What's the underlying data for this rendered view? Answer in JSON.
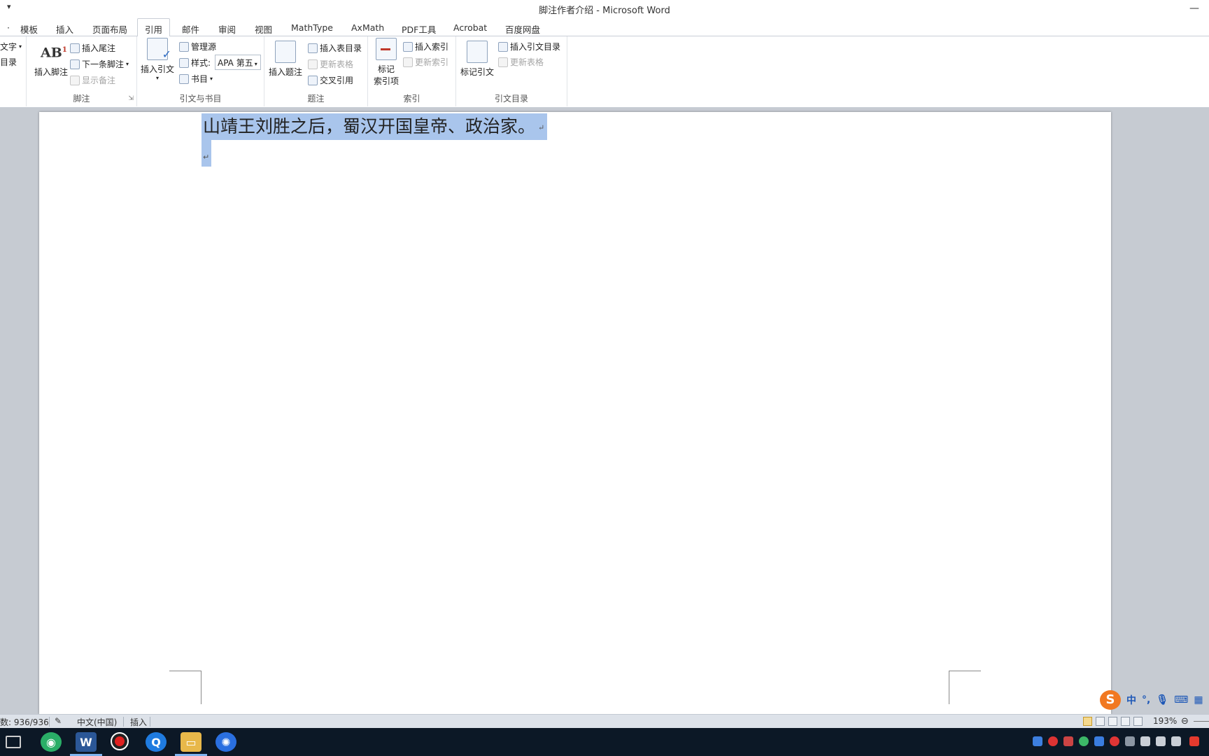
{
  "window": {
    "title": "脚注作者介绍 - Microsoft Word",
    "quick_access_arrow": "▾",
    "minimize_glyph": "—"
  },
  "tabs": [
    {
      "label": "模板"
    },
    {
      "label": "插入"
    },
    {
      "label": "页面布局"
    },
    {
      "label": "引用",
      "active": true
    },
    {
      "label": "邮件"
    },
    {
      "label": "审阅"
    },
    {
      "label": "视图"
    },
    {
      "label": "MathType"
    },
    {
      "label": "AxMath"
    },
    {
      "label": "PDF工具"
    },
    {
      "label": "Acrobat"
    },
    {
      "label": "百度网盘"
    }
  ],
  "ribbon": {
    "toc_group": {
      "add_text": "文字",
      "update_table": "目录"
    },
    "footnotes": {
      "label": "脚注",
      "insert_footnote": "插入脚注",
      "insert_endnote": "插入尾注",
      "next_footnote": "下一条脚注",
      "show_notes": "显示备注"
    },
    "citations": {
      "label": "引文与书目",
      "insert_citation": "插入引文",
      "manage_sources": "管理源",
      "style_label": "样式:",
      "style_value": "APA 第五",
      "bibliography": "书目"
    },
    "captions": {
      "label": "题注",
      "insert_caption": "插入题注",
      "insert_table_of_figures": "插入表目录",
      "update_table": "更新表格",
      "cross_reference": "交叉引用"
    },
    "index": {
      "label": "索引",
      "mark_entry_line1": "标记",
      "mark_entry_line2": "索引项",
      "insert_index": "插入索引",
      "update_index": "更新索引"
    },
    "toa": {
      "label": "引文目录",
      "mark_citation": "标记引文",
      "insert_toa": "插入引文目录",
      "update_table": "更新表格"
    }
  },
  "document": {
    "line1": "山靖王刘胜之后，蜀汉开国皇帝、政治家。",
    "paragraph_mark": "↵"
  },
  "ime": {
    "logo": "S",
    "mode": "中",
    "punct": "°,"
  },
  "status": {
    "word_count": "数: 936/936",
    "language": "中文(中国)",
    "mode": "插入",
    "zoom": "193%"
  },
  "colors": {
    "selection": "#a9c5ec",
    "doc_background": "#c6cbd2",
    "taskbar": "#0c1826",
    "statusbar": "#dde2e9"
  }
}
